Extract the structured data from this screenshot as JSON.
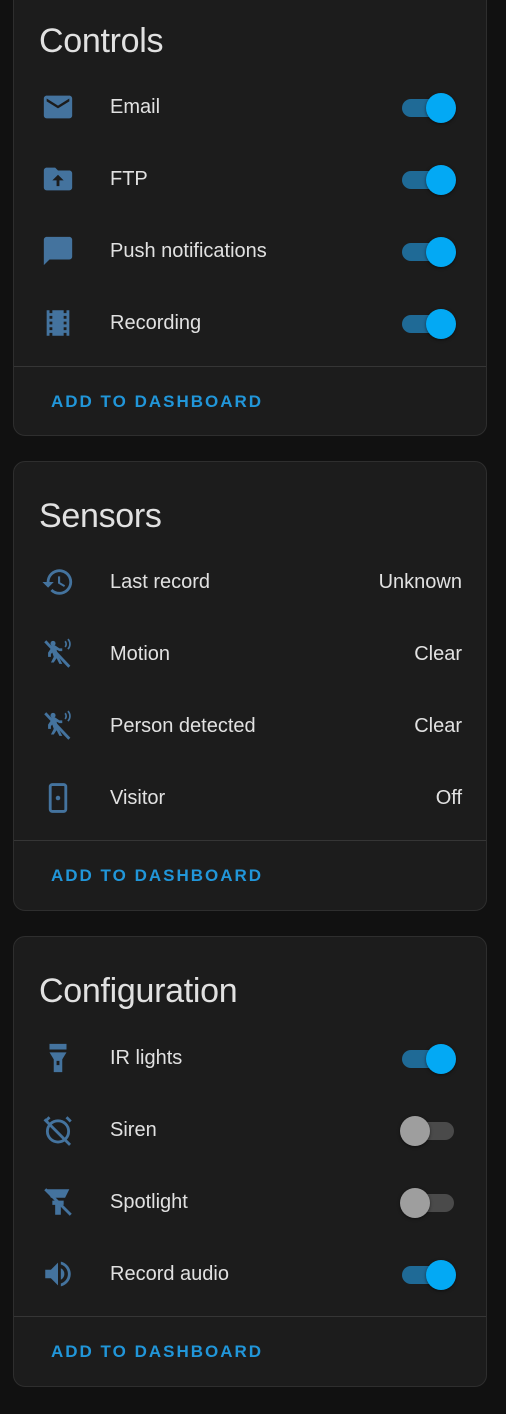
{
  "colors": {
    "background": "#111111",
    "card": "#1c1c1c",
    "accent": "#03a9f4",
    "icon": "#44739e",
    "text": "#e1e1e1"
  },
  "controls": {
    "title": "Controls",
    "items": [
      {
        "label": "Email",
        "icon": "email-icon",
        "state": "on"
      },
      {
        "label": "FTP",
        "icon": "folder-upload-icon",
        "state": "on"
      },
      {
        "label": "Push notifications",
        "icon": "message-icon",
        "state": "on"
      },
      {
        "label": "Recording",
        "icon": "filmstrip-icon",
        "state": "on"
      }
    ],
    "action": "ADD TO DASHBOARD"
  },
  "sensors": {
    "title": "Sensors",
    "items": [
      {
        "label": "Last record",
        "icon": "history-icon",
        "value": "Unknown"
      },
      {
        "label": "Motion",
        "icon": "motion-sensor-off-icon",
        "value": "Clear"
      },
      {
        "label": "Person detected",
        "icon": "motion-sensor-off-icon",
        "value": "Clear"
      },
      {
        "label": "Visitor",
        "icon": "doorbell-icon",
        "value": "Off"
      }
    ],
    "action": "ADD TO DASHBOARD"
  },
  "configuration": {
    "title": "Configuration",
    "items": [
      {
        "label": "IR lights",
        "icon": "flashlight-icon",
        "state": "on"
      },
      {
        "label": "Siren",
        "icon": "alarm-off-icon",
        "state": "off"
      },
      {
        "label": "Spotlight",
        "icon": "spotlight-off-icon",
        "state": "off"
      },
      {
        "label": "Record audio",
        "icon": "volume-icon",
        "state": "on"
      }
    ],
    "action": "ADD TO DASHBOARD"
  }
}
